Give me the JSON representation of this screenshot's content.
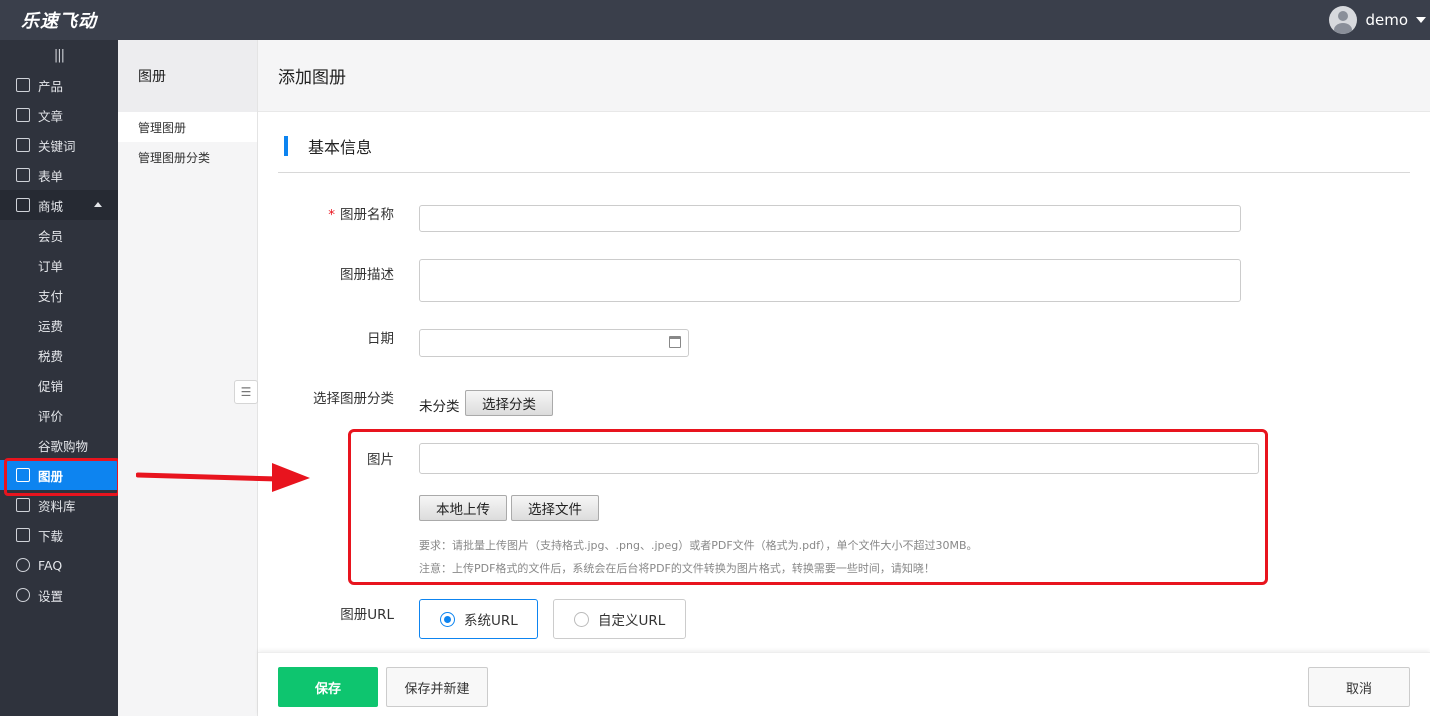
{
  "app": {
    "logo": "乐速飞动"
  },
  "user": {
    "name": "demo"
  },
  "sidebar": {
    "collapse": "|||",
    "items": [
      {
        "label": "产品",
        "icon": "grid-icon"
      },
      {
        "label": "文章",
        "icon": "article-icon"
      },
      {
        "label": "关键词",
        "icon": "keyword-icon"
      },
      {
        "label": "表单",
        "icon": "clipboard-icon"
      },
      {
        "label": "商城",
        "icon": "shopping-bag-icon"
      },
      {
        "label": "会员"
      },
      {
        "label": "订单"
      },
      {
        "label": "支付"
      },
      {
        "label": "运费"
      },
      {
        "label": "税费"
      },
      {
        "label": "促销"
      },
      {
        "label": "评价"
      },
      {
        "label": "谷歌购物"
      },
      {
        "label": "图册",
        "icon": "gallery-icon"
      },
      {
        "label": "资料库",
        "icon": "database-icon"
      },
      {
        "label": "下载",
        "icon": "download-icon"
      },
      {
        "label": "FAQ",
        "icon": "chat-icon"
      },
      {
        "label": "设置",
        "icon": "gear-icon"
      }
    ]
  },
  "subpanel": {
    "title": "图册",
    "links": [
      "管理图册",
      "管理图册分类"
    ],
    "toggle": "☰"
  },
  "main": {
    "title": "添加图册",
    "section": "基本信息",
    "fields": {
      "name_label": "图册名称",
      "desc_label": "图册描述",
      "date_label": "日期",
      "category_label": "选择图册分类",
      "category_value": "未分类",
      "category_button": "选择分类",
      "image_label": "图片",
      "upload_local": "本地上传",
      "choose_file": "选择文件",
      "hint1": "要求：请批量上传图片（支持格式.jpg、.png、.jpeg）或者PDF文件（格式为.pdf），单个文件大小不超过30MB。",
      "hint2": "注意：上传PDF格式的文件后，系统会在后台将PDF的文件转换为图片格式，转换需要一些时间，请知晓！",
      "url_label": "图册URL",
      "url_option_system": "系统URL",
      "url_option_custom": "自定义URL"
    },
    "footer": {
      "save": "保存",
      "save_new": "保存并新建",
      "cancel": "取消"
    }
  },
  "colors": {
    "accent": "#0d84f0",
    "highlight": "#e8141e",
    "save": "#0ec56f"
  }
}
